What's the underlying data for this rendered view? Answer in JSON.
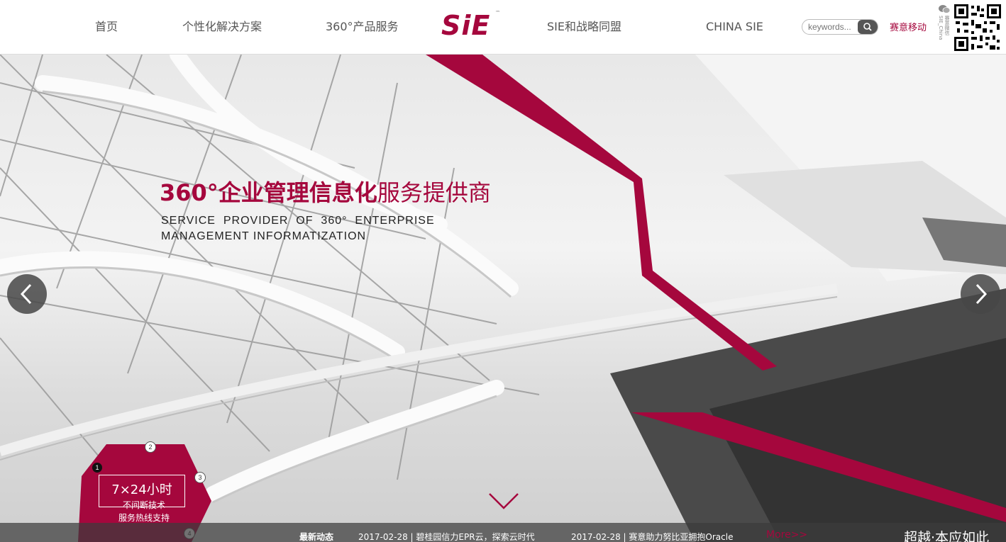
{
  "nav": {
    "home": "首页",
    "solutions": "个性化解决方案",
    "services": "360°产品服务",
    "logo": "SiE",
    "logo_tm": "™",
    "alliance": "SIE和战略同盟",
    "china": "CHINA SIE"
  },
  "search": {
    "placeholder": "keywords..."
  },
  "mobile": {
    "label": "赛意移动"
  },
  "wechat": {
    "caption": "赛意微信 SIE_China"
  },
  "hero": {
    "headline_bold": "360°企业管理信息化",
    "headline_light": "服务提供商",
    "subtitle_line1": "SERVICE  PROVIDER  OF  360°  ENTERPRISE",
    "subtitle_line2": "MANAGEMENT INFORMATIZATION"
  },
  "badge": {
    "title": "7×24小时",
    "line1": "不间断技术",
    "line2": "服务热线支持",
    "steps": [
      "1",
      "2",
      "3",
      "4"
    ]
  },
  "news": {
    "label": "最新动态",
    "items": [
      "2017-02-28 | 碧桂园信力EPR云，探索云时代",
      "2017-02-28 | 赛意助力努比亚拥抱Oracle"
    ],
    "more": "More>>"
  },
  "slogan": "超越·本应如此",
  "colors": {
    "brand": "#a5073d",
    "header_bg": "#ffffff",
    "bar": "#3c3c3c"
  }
}
